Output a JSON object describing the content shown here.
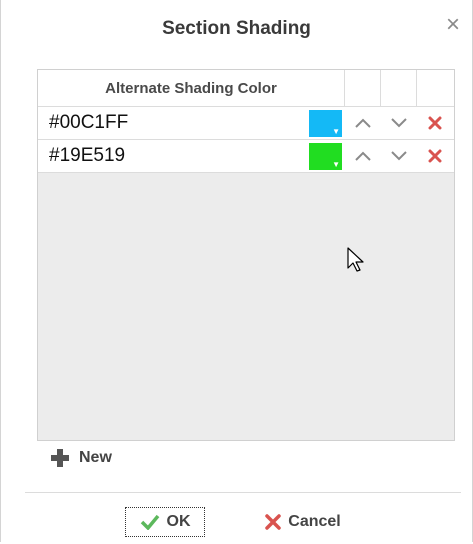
{
  "dialog": {
    "title": "Section Shading",
    "close_icon": "close-icon"
  },
  "grid": {
    "header": "Alternate Shading Color",
    "rows": [
      {
        "value": "#00C1FF",
        "swatch_color": "#14B9F6"
      },
      {
        "value": "#19E519",
        "swatch_color": "#21DD21"
      }
    ]
  },
  "new_button": {
    "label": "New",
    "icon": "plus-icon"
  },
  "footer": {
    "ok_label": "OK",
    "cancel_label": "Cancel",
    "ok_icon": "checkmark-icon",
    "cancel_icon": "x-icon"
  },
  "colors": {
    "delete": "#d9534f",
    "ok_check": "#5cb85c",
    "arrow": "#8a8a8a"
  }
}
